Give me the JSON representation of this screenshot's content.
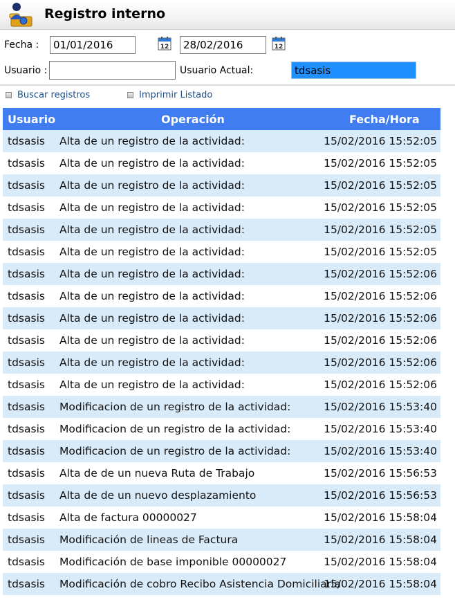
{
  "header": {
    "title": "Registro interno",
    "icon": "users-folder-icon"
  },
  "filters": {
    "fecha_label": "Fecha :",
    "fecha_desde": "01/01/2016",
    "fecha_hasta": "28/02/2016",
    "usuario_label": "Usuario :",
    "usuario_value": "",
    "usuario_actual_label": "Usuario Actual:",
    "usuario_actual_value": "tdsasis",
    "calendar_icon": "calendar-icon"
  },
  "actions": {
    "buscar": "Buscar registros",
    "imprimir": "Imprimir Listado"
  },
  "colors": {
    "header_bg": "#3f7df0",
    "row_alt": "#d9ebf9",
    "link": "#1c4f8a"
  },
  "table": {
    "columns": [
      "Usuario",
      "Operación",
      "Fecha/Hora"
    ],
    "rows": [
      [
        "tdsasis",
        "Alta de un registro de la actividad:",
        "15/02/2016 15:52:05"
      ],
      [
        "tdsasis",
        "Alta de un registro de la actividad:",
        "15/02/2016 15:52:05"
      ],
      [
        "tdsasis",
        "Alta de un registro de la actividad:",
        "15/02/2016 15:52:05"
      ],
      [
        "tdsasis",
        "Alta de un registro de la actividad:",
        "15/02/2016 15:52:05"
      ],
      [
        "tdsasis",
        "Alta de un registro de la actividad:",
        "15/02/2016 15:52:05"
      ],
      [
        "tdsasis",
        "Alta de un registro de la actividad:",
        "15/02/2016 15:52:05"
      ],
      [
        "tdsasis",
        "Alta de un registro de la actividad:",
        "15/02/2016 15:52:06"
      ],
      [
        "tdsasis",
        "Alta de un registro de la actividad:",
        "15/02/2016 15:52:06"
      ],
      [
        "tdsasis",
        "Alta de un registro de la actividad:",
        "15/02/2016 15:52:06"
      ],
      [
        "tdsasis",
        "Alta de un registro de la actividad:",
        "15/02/2016 15:52:06"
      ],
      [
        "tdsasis",
        "Alta de un registro de la actividad:",
        "15/02/2016 15:52:06"
      ],
      [
        "tdsasis",
        "Alta de un registro de la actividad:",
        "15/02/2016 15:52:06"
      ],
      [
        "tdsasis",
        "Modificacion de un registro de la actividad:",
        "15/02/2016 15:53:40"
      ],
      [
        "tdsasis",
        "Modificacion de un registro de la actividad:",
        "15/02/2016 15:53:40"
      ],
      [
        "tdsasis",
        "Modificacion de un registro de la actividad:",
        "15/02/2016 15:53:40"
      ],
      [
        "tdsasis",
        "Alta de de un nueva Ruta de Trabajo",
        "15/02/2016 15:56:53"
      ],
      [
        "tdsasis",
        "Alta de de un nuevo desplazamiento",
        "15/02/2016 15:56:53"
      ],
      [
        "tdsasis",
        "Alta de factura 00000027",
        "15/02/2016 15:58:04"
      ],
      [
        "tdsasis",
        "Modificación de lineas de Factura",
        "15/02/2016 15:58:04"
      ],
      [
        "tdsasis",
        "Modificación de base imponible 00000027",
        "15/02/2016 15:58:04"
      ],
      [
        "tdsasis",
        "Modificación de cobro Recibo Asistencia Domiciliaria",
        "15/02/2016 15:58:04"
      ]
    ]
  }
}
